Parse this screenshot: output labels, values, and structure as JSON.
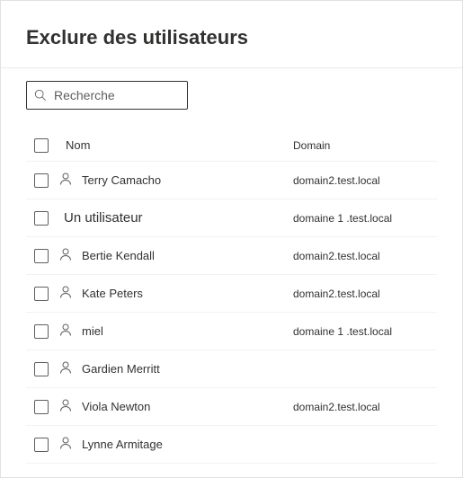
{
  "title": "Exclure des utilisateurs",
  "search": {
    "placeholder": "Recherche"
  },
  "columns": {
    "name": "Nom",
    "domain": "Domain"
  },
  "rows": [
    {
      "name": "Terry Camacho",
      "domain": "domain2.test.local",
      "showIcon": true,
      "special": false
    },
    {
      "name": "Un utilisateur",
      "domain": "domaine 1 .test.local",
      "showIcon": false,
      "special": true
    },
    {
      "name": "Bertie  Kendall",
      "domain": "domain2.test.local",
      "showIcon": true,
      "special": false
    },
    {
      "name": "Kate Peters",
      "domain": "domain2.test.local",
      "showIcon": true,
      "special": false
    },
    {
      "name": "miel",
      "domain": "domaine 1 .test.local",
      "showIcon": true,
      "special": false
    },
    {
      "name": "Gardien Merritt",
      "domain": "",
      "showIcon": true,
      "special": false
    },
    {
      "name": "Viola Newton",
      "domain": "domain2.test.local",
      "showIcon": true,
      "special": false
    },
    {
      "name": "Lynne Armitage",
      "domain": "",
      "showIcon": true,
      "special": false
    }
  ]
}
